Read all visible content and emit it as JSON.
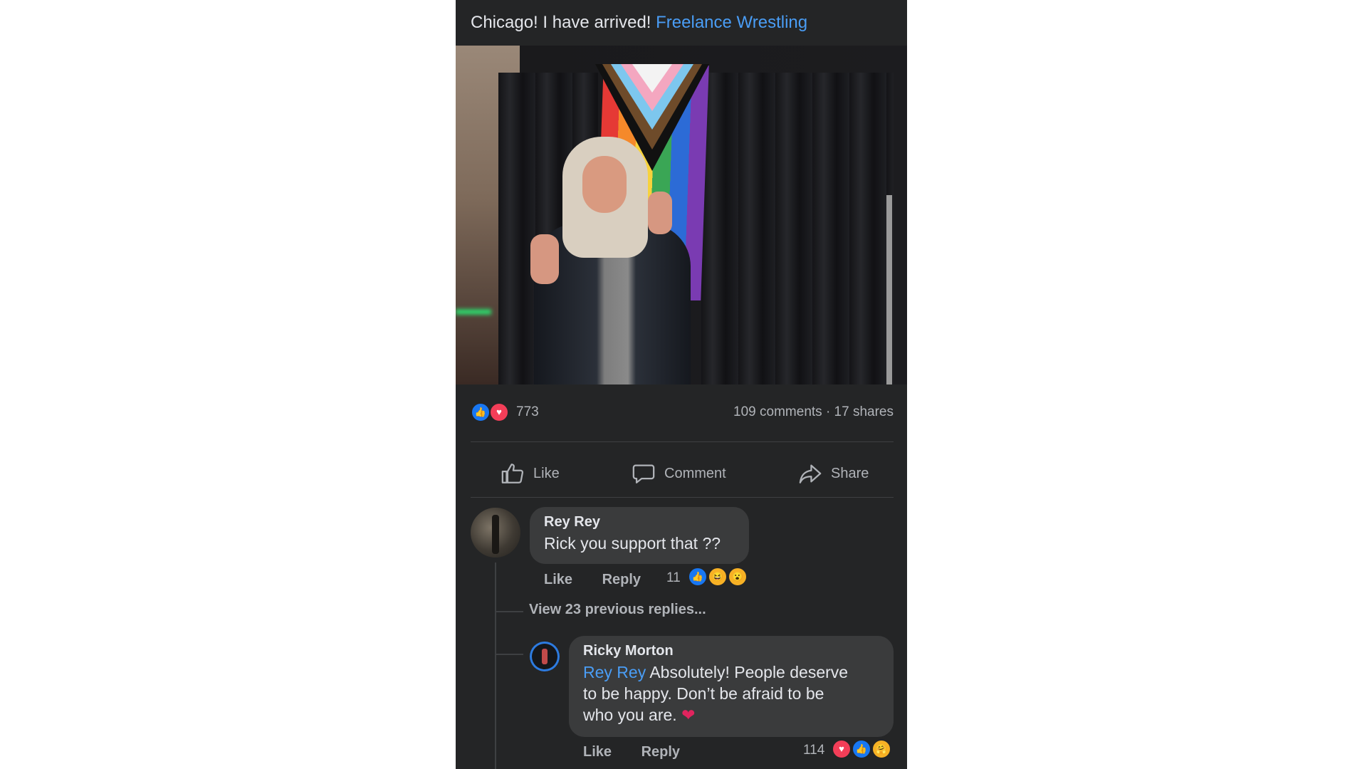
{
  "post": {
    "text": "Chicago! I have arrived!",
    "tagged_page": "Freelance Wrestling",
    "reaction_count": "773",
    "comments_shares": "109 comments · 17 shares"
  },
  "actions": {
    "like": "Like",
    "comment": "Comment",
    "share": "Share"
  },
  "comments": [
    {
      "author": "Rey Rey",
      "text": "Rick you support that ??",
      "like_label": "Like",
      "reply_label": "Reply",
      "reaction_count": "11"
    }
  ],
  "view_replies": "View 23 previous replies...",
  "reply": {
    "author": "Ricky Morton",
    "mention": "Rey Rey",
    "text_line1": "Absolutely! People deserve",
    "text_line2": "to be happy. Don’t be afraid to be",
    "text_line3": "who you are.",
    "like_label": "Like",
    "reply_label": "Reply",
    "reaction_count": "114"
  },
  "icons": {
    "like": "thumbs-up-icon",
    "comment": "speech-bubble-icon",
    "share": "share-arrow-icon",
    "heart": "heart-emoji"
  },
  "colors": {
    "background": "#242526",
    "link": "#4a9df5",
    "bubble": "#3a3b3c",
    "muted_text": "#b0b3b8"
  }
}
